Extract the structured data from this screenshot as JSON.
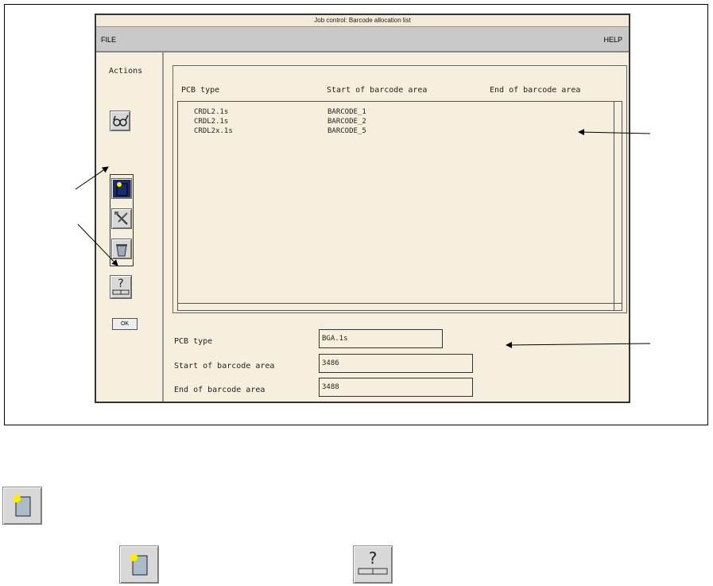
{
  "window": {
    "title": "Job control: Barcode allocation list"
  },
  "menu": {
    "file": "FILE",
    "help": "HELP"
  },
  "sidebar": {
    "actions_label": "Actions",
    "ok_label": "OK"
  },
  "list": {
    "headers": [
      "PCB type",
      "Start of barcode area",
      "End of barcode area"
    ],
    "rows": [
      {
        "pcb": "CRDL2.1s",
        "start": "BARCODE_1"
      },
      {
        "pcb": "CRDL2.1s",
        "start": "BARCODE_2"
      },
      {
        "pcb": "CRDL2x.1s",
        "start": "BARCODE_5"
      }
    ]
  },
  "form": {
    "pcb_type": {
      "label": "PCB type",
      "value": "BGA.1s"
    },
    "start": {
      "label": "Start of barcode area",
      "value": "3486"
    },
    "end": {
      "label": "End of barcode area",
      "value": "3488"
    }
  },
  "icons": [
    "glasses-icon",
    "new-entry-icon",
    "edit-tools-icon",
    "delete-bucket-icon",
    "help-icon"
  ]
}
